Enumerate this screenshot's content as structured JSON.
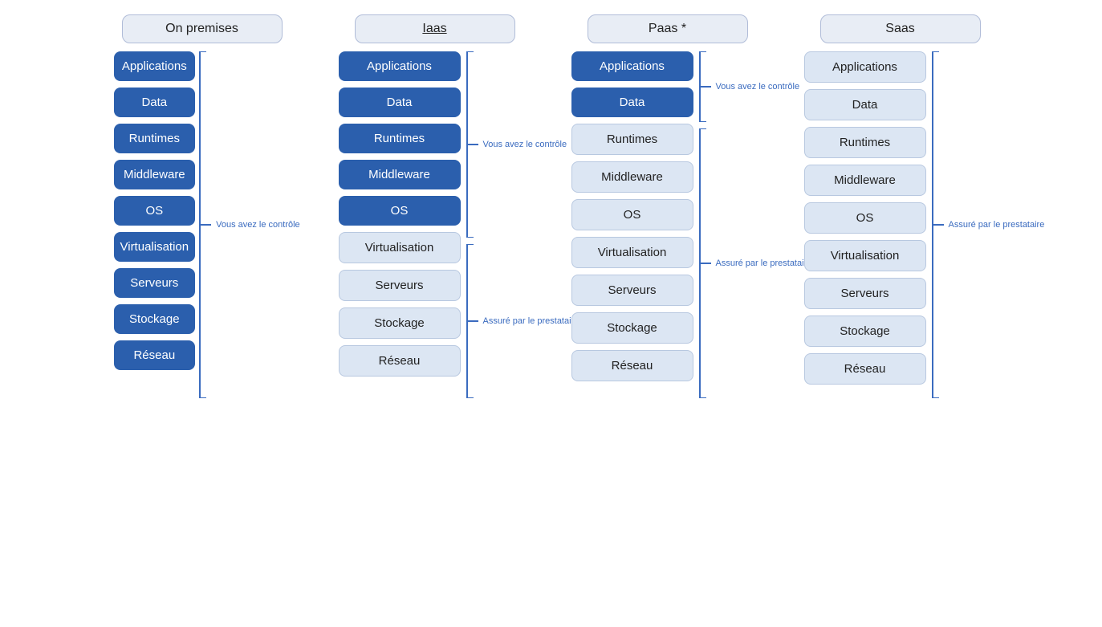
{
  "columns": [
    {
      "id": "on-premises",
      "header": "On premises",
      "headerUnderline": false,
      "items": [
        {
          "label": "Applications",
          "style": "blue"
        },
        {
          "label": "Data",
          "style": "blue"
        },
        {
          "label": "Runtimes",
          "style": "blue"
        },
        {
          "label": "Middleware",
          "style": "blue"
        },
        {
          "label": "OS",
          "style": "blue"
        },
        {
          "label": "Virtualisation",
          "style": "blue"
        },
        {
          "label": "Serveurs",
          "style": "blue"
        },
        {
          "label": "Stockage",
          "style": "blue"
        },
        {
          "label": "Réseau",
          "style": "blue"
        }
      ],
      "brackets": []
    },
    {
      "id": "iaas",
      "header": "Iaas",
      "headerUnderline": true,
      "items": [
        {
          "label": "Applications",
          "style": "blue"
        },
        {
          "label": "Data",
          "style": "blue"
        },
        {
          "label": "Runtimes",
          "style": "blue"
        },
        {
          "label": "Middleware",
          "style": "blue"
        },
        {
          "label": "OS",
          "style": "blue"
        },
        {
          "label": "Virtualisation",
          "style": "light"
        },
        {
          "label": "Serveurs",
          "style": "light"
        },
        {
          "label": "Stockage",
          "style": "light"
        },
        {
          "label": "Réseau",
          "style": "light"
        }
      ],
      "bracketRight": {
        "topLabel": "Vous avez le contrôle",
        "topItems": 5,
        "bottomLabel": "Assuré par le prestataire",
        "bottomItems": 4
      }
    },
    {
      "id": "paas",
      "header": "Paas *",
      "headerUnderline": false,
      "items": [
        {
          "label": "Applications",
          "style": "blue"
        },
        {
          "label": "Data",
          "style": "blue"
        },
        {
          "label": "Runtimes",
          "style": "light"
        },
        {
          "label": "Middleware",
          "style": "light"
        },
        {
          "label": "OS",
          "style": "light"
        },
        {
          "label": "Virtualisation",
          "style": "light"
        },
        {
          "label": "Serveurs",
          "style": "light"
        },
        {
          "label": "Stockage",
          "style": "light"
        },
        {
          "label": "Réseau",
          "style": "light"
        }
      ],
      "bracketRight": {
        "topLabel": "Vous avez le contrôle",
        "topItems": 2,
        "bottomLabel": "Assuré par le prestataire",
        "bottomItems": 7
      }
    },
    {
      "id": "saas",
      "header": "Saas",
      "headerUnderline": false,
      "items": [
        {
          "label": "Applications",
          "style": "light"
        },
        {
          "label": "Data",
          "style": "light"
        },
        {
          "label": "Runtimes",
          "style": "light"
        },
        {
          "label": "Middleware",
          "style": "light"
        },
        {
          "label": "OS",
          "style": "light"
        },
        {
          "label": "Virtualisation",
          "style": "light"
        },
        {
          "label": "Serveurs",
          "style": "light"
        },
        {
          "label": "Stockage",
          "style": "light"
        },
        {
          "label": "Réseau",
          "style": "light"
        }
      ],
      "bracketRight": {
        "topLabel": null,
        "topItems": 0,
        "bottomLabel": "Assuré par le prestataire",
        "bottomItems": 9
      }
    }
  ],
  "on_premises_bracket": "Vous avez le contrôle",
  "item_height": 40,
  "item_gap": 8
}
